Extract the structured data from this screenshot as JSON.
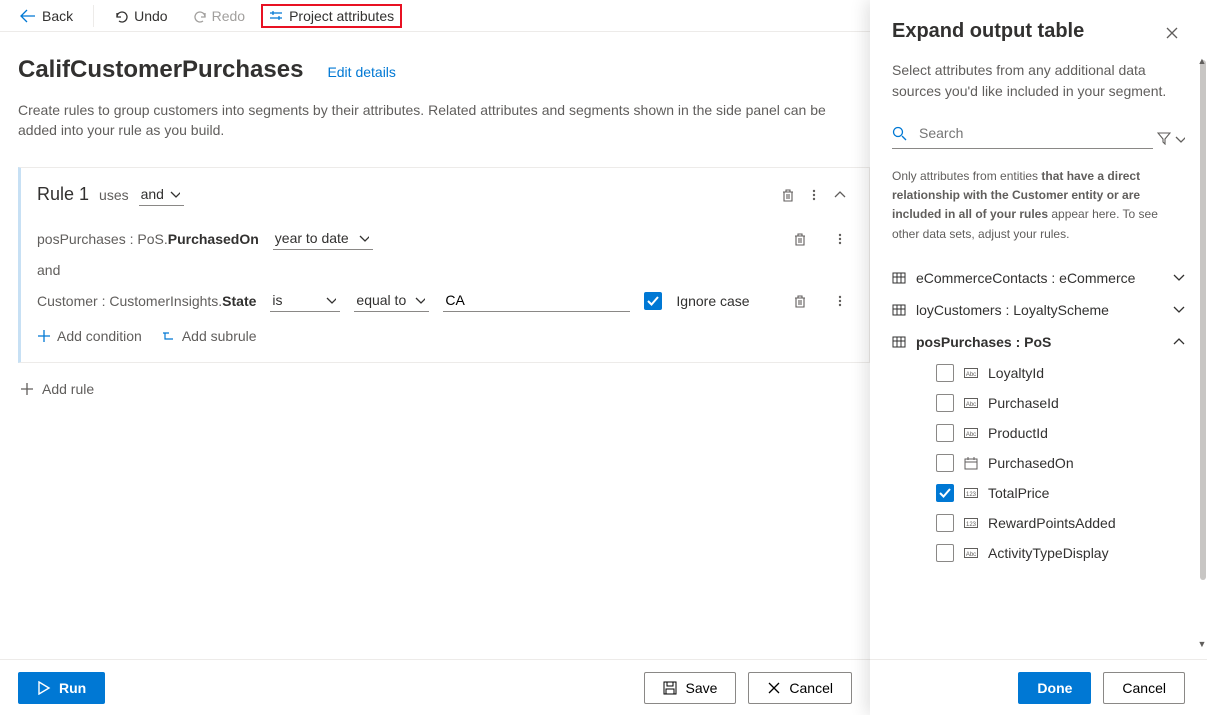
{
  "toolbar": {
    "back": "Back",
    "undo": "Undo",
    "redo": "Redo",
    "project_attributes": "Project attributes"
  },
  "page": {
    "title": "CalifCustomerPurchases",
    "edit_details": "Edit details",
    "description": "Create rules to group customers into segments by their attributes. Related attributes and segments shown in the side panel can be added into your rule as you build."
  },
  "rule": {
    "title": "Rule 1",
    "uses": "uses",
    "join_op": "and",
    "row1_attr_prefix": "posPurchases : PoS.",
    "row1_attr_bold": "PurchasedOn",
    "row1_op": "year to date",
    "and": "and",
    "row2_attr_prefix": "Customer : CustomerInsights.",
    "row2_attr_bold": "State",
    "row2_op1": "is",
    "row2_op2": "equal to",
    "row2_value": "CA",
    "ignore_case": "Ignore case",
    "add_condition": "Add condition",
    "add_subrule": "Add subrule"
  },
  "add_rule": "Add rule",
  "footer": {
    "run": "Run",
    "save": "Save",
    "cancel": "Cancel"
  },
  "panel": {
    "title": "Expand output table",
    "desc": "Select attributes from any additional data sources you'd like included in your segment.",
    "search_placeholder": "Search",
    "note_pre": "Only attributes from entities ",
    "note_bold": "that have a direct relationship with the Customer entity or are included in all of your rules",
    "note_post": " appear here. To see other data sets, adjust your rules.",
    "entities": [
      {
        "label": "eCommerceContacts : eCommerce",
        "expanded": false
      },
      {
        "label": "loyCustomers : LoyaltyScheme",
        "expanded": false
      },
      {
        "label": "posPurchases : PoS",
        "expanded": true
      }
    ],
    "pos_attrs": [
      {
        "label": "LoyaltyId",
        "icon": "abc",
        "checked": false
      },
      {
        "label": "PurchaseId",
        "icon": "abc",
        "checked": false
      },
      {
        "label": "ProductId",
        "icon": "abc",
        "checked": false
      },
      {
        "label": "PurchasedOn",
        "icon": "date",
        "checked": false
      },
      {
        "label": "TotalPrice",
        "icon": "num",
        "checked": true
      },
      {
        "label": "RewardPointsAdded",
        "icon": "num",
        "checked": false
      },
      {
        "label": "ActivityTypeDisplay",
        "icon": "abc",
        "checked": false
      }
    ],
    "done": "Done",
    "cancel": "Cancel"
  }
}
